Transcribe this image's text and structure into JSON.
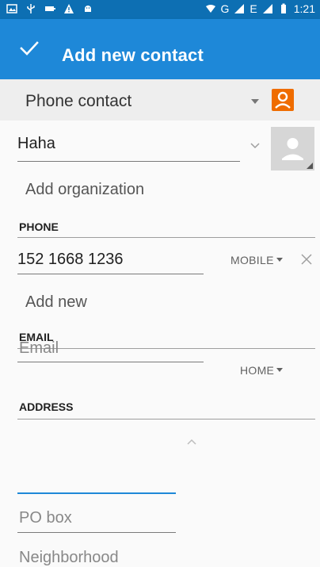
{
  "status_bar": {
    "time": "1:21",
    "network_label": "G",
    "network_label_2": "E"
  },
  "app_bar": {
    "title": "Add new contact",
    "confirm_icon": "check-icon",
    "color": "#1e88d8"
  },
  "account": {
    "label": "Phone contact",
    "badge_color": "#ef6c00"
  },
  "name": {
    "value": "Haha"
  },
  "organization": {
    "label": "Add organization"
  },
  "phone": {
    "header": "PHONE",
    "value": "152 1668 1236",
    "type": "MOBILE",
    "add_label": "Add new"
  },
  "email": {
    "header": "EMAIL",
    "placeholder": "Email",
    "type": "HOME"
  },
  "address": {
    "header": "ADDRESS",
    "pobox_placeholder": "PO box",
    "neighborhood_placeholder": "Neighborhood"
  }
}
